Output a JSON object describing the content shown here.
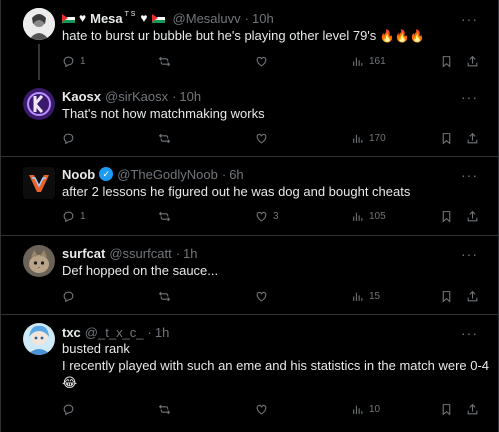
{
  "tweets": [
    {
      "name": "Mesa",
      "name_suffix": "T S",
      "handle": "@Mesaluvv",
      "time": "10h",
      "text_lines": [
        "hate to burst ur bubble but he's playing other level 79's"
      ],
      "emoji": "🔥🔥🔥",
      "reply_count": "1",
      "retweet_count": "",
      "like_count": "",
      "views_count": "161"
    },
    {
      "name": "Kaosx",
      "handle": "@sirKaosx",
      "time": "10h",
      "text_lines": [
        "That's not how matchmaking works"
      ],
      "reply_count": "",
      "retweet_count": "",
      "like_count": "",
      "views_count": "170"
    },
    {
      "name": "Noob",
      "handle": "@TheGodlyNoob",
      "time": "6h",
      "text_lines": [
        "after 2 lessons he figured out he was dog and bought cheats"
      ],
      "reply_count": "1",
      "retweet_count": "",
      "like_count": "3",
      "views_count": "105"
    },
    {
      "name": "surfcat",
      "handle": "@ssurfcatt",
      "time": "1h",
      "text_lines": [
        "Def hopped on the sauce..."
      ],
      "reply_count": "",
      "retweet_count": "",
      "like_count": "",
      "views_count": "15"
    },
    {
      "name": "txc",
      "handle": "@_t_x_c_",
      "time": "1h",
      "text_lines": [
        "busted rank",
        "I recently played with such an eme and his statistics in the match were 0-4"
      ],
      "emoji": "😂",
      "reply_count": "",
      "retweet_count": "",
      "like_count": "",
      "views_count": "10"
    }
  ],
  "more_glyph": "···",
  "separator": "·",
  "icons": [
    "reply-icon",
    "retweet-icon",
    "like-icon",
    "views-icon",
    "bookmark-icon",
    "share-icon",
    "verified-badge-icon",
    "heart-emoji-icon",
    "palestine-flag-icon"
  ],
  "colors": {
    "background": "#000000",
    "text": "#e7e9ea",
    "muted": "#71767b",
    "border": "#2f3336",
    "verified": "#1d9bf0"
  }
}
